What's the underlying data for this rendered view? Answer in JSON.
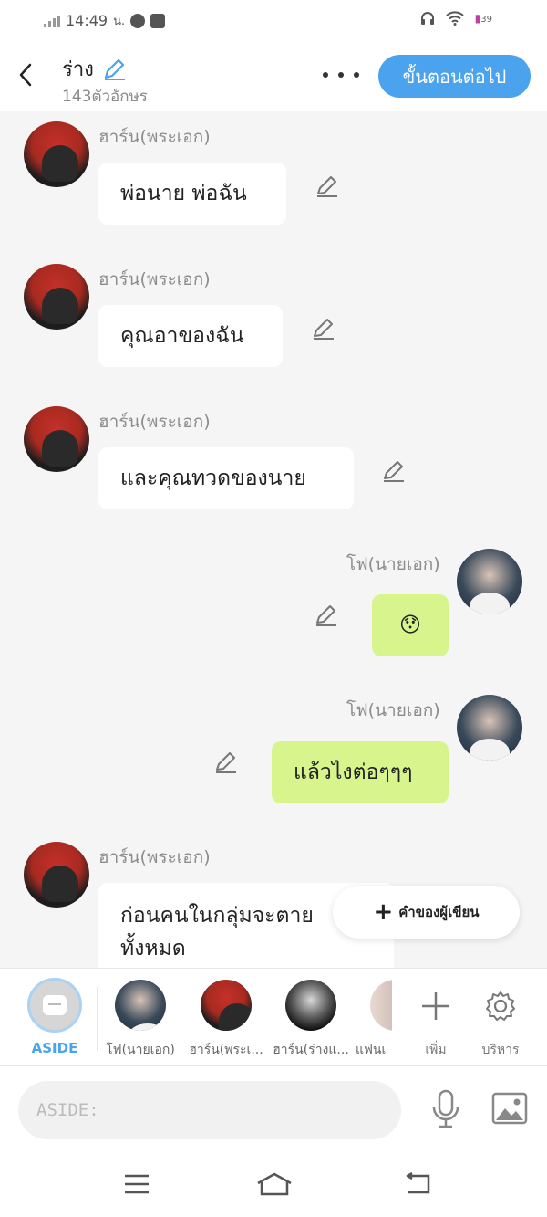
{
  "status_bar": {
    "time": "14:49",
    "time_suffix": "น.",
    "battery": "39"
  },
  "header": {
    "title": "ร่าง",
    "char_count": "143ตัวอักษร",
    "next_button": "ขั้นตอนต่อไป"
  },
  "messages": [
    {
      "sender": "ฮาร์น(พระเอก)",
      "text": "พ่อนาย พ่อฉัน",
      "side": "left"
    },
    {
      "sender": "ฮาร์น(พระเอก)",
      "text": "คุณอาของฉัน",
      "side": "left"
    },
    {
      "sender": "ฮาร์น(พระเอก)",
      "text": "และคุณทวดของนาย",
      "side": "left"
    },
    {
      "sender": "โฟ(นายเอก)",
      "text": "😯",
      "side": "right"
    },
    {
      "sender": "โฟ(นายเอก)",
      "text": "แล้วไงต่อๆๆๆ",
      "side": "right"
    },
    {
      "sender": "ฮาร์น(พระเอก)",
      "text_line1": "ก่อนคนในกลุ่มจะตาย",
      "text_line2": "ทั้งหมด",
      "side": "left"
    }
  ],
  "floating_button": {
    "label": "คำของผู้เขียน"
  },
  "character_bar": {
    "aside_label": "ASIDE",
    "characters": [
      {
        "name": "โฟ(นายเอก)"
      },
      {
        "name": "ฮาร์น(พระเ..."
      },
      {
        "name": "ฮาร์น(ร่างแ..."
      },
      {
        "name": "แฟนเ"
      }
    ],
    "add_label": "เพิ่ม",
    "manage_label": "บริหาร"
  },
  "input": {
    "placeholder": "ASIDE:"
  },
  "colors": {
    "accent": "#4aa3ec",
    "green_bubble": "#d7f48d",
    "chat_bg": "#f5f5f6"
  }
}
